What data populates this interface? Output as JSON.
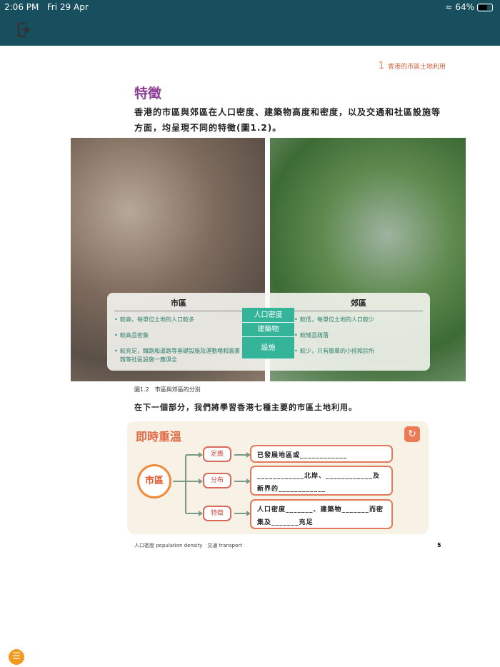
{
  "status": {
    "time": "2:06 PM",
    "date": "Fri 29 Apr",
    "battery": "64%",
    "battery_level": 0.64
  },
  "chapter": {
    "number": "1",
    "title": "香港的市區土地利用"
  },
  "section_title": "特徵",
  "intro": "香港的市區與郊區在人口密度、建築物高度和密度，以及交通和社區設施等方面，均呈現不同的特徵(圖1.2)。",
  "comparison": {
    "urban": {
      "heading": "市區",
      "points": [
        "較高，每單位土地的人口較多",
        "較高且密集",
        "較充足，鐵路和道路等基礎設施及運動場和圖書館等社區設施一應俱全"
      ]
    },
    "rural": {
      "heading": "郊區",
      "points": [
        "較低，每單位土地的人口較少",
        "較矮且疏落",
        "較少，只有簡單的小徑和診所"
      ]
    },
    "criteria": [
      "人口密度",
      "建築物",
      "設施"
    ]
  },
  "caption": "圖1.2　市區與郊區的分別",
  "next_text": "在下一個部分，我們將學習香港七種主要的市區土地利用。",
  "review": {
    "title": "即時重溫",
    "hub": "市區",
    "tags": [
      "定義",
      "分布",
      "特徵"
    ],
    "boxes": [
      "已發展地區或____________",
      "____________北岸、____________及新界的____________",
      "人口密度_______、建築物_______而密集及_______充足"
    ]
  },
  "footer": {
    "terms": "人口密度 population density　交通 transport",
    "page": "5"
  }
}
